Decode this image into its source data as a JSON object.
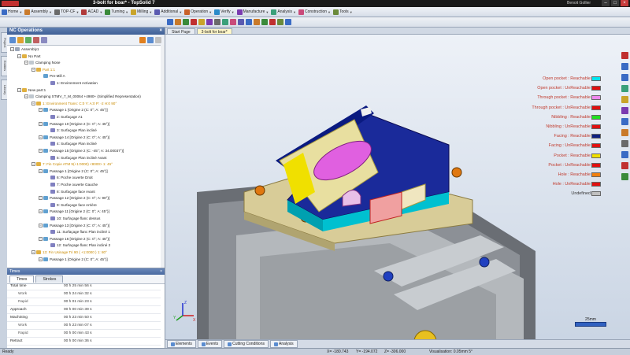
{
  "app": {
    "title": "3-bolt for boar* - TopSolid 7",
    "user": "Benoit Gollier"
  },
  "window_controls": {
    "minimize": "–",
    "maximize": "□",
    "close": "×"
  },
  "menus": [
    {
      "label": "Home",
      "color": "#3a6bc4"
    },
    {
      "label": "Assembly",
      "color": "#c97a2a"
    },
    {
      "label": "TOP-CF",
      "color": "#6a6a6a"
    },
    {
      "label": "ACAD",
      "color": "#b03a3a"
    },
    {
      "label": "Turning",
      "color": "#3a8a3a"
    },
    {
      "label": "Milling",
      "color": "#c9a42a"
    },
    {
      "label": "Additional",
      "color": "#5a5ab0"
    },
    {
      "label": "Operation",
      "color": "#c9622a"
    },
    {
      "label": "Verify",
      "color": "#2a8ac9"
    },
    {
      "label": "Manufacture",
      "color": "#7a3ab0"
    },
    {
      "label": "Analysis",
      "color": "#3aa07a"
    },
    {
      "label": "Construction",
      "color": "#c94a7a"
    },
    {
      "label": "Tools",
      "color": "#6a8a3a"
    }
  ],
  "nc_panel": {
    "title": "NC Operations",
    "close": "×",
    "tree": [
      {
        "indent": 0,
        "exp": "−",
        "label": "Assembly1",
        "icon": "#9aa6b8",
        "style": ""
      },
      {
        "indent": 1,
        "exp": "−",
        "label": "No Part",
        "icon": "#e0b040",
        "style": ""
      },
      {
        "indent": 2,
        "exp": "−",
        "label": "Clamping Nose",
        "icon": "#c0c8d0",
        "style": ""
      },
      {
        "indent": 3,
        "exp": "−",
        "label": "Part 1:1",
        "icon": "#e0b040",
        "style": "hi"
      },
      {
        "indent": 4,
        "exp": "",
        "label": "Pre-Mill A",
        "icon": "#60a0d0",
        "style": ""
      },
      {
        "indent": 5,
        "exp": "",
        "label": "1: Environment Activation",
        "icon": "#8080c0",
        "style": ""
      },
      {
        "indent": 1,
        "exp": "−",
        "label": "New part:1",
        "icon": "#e0b040",
        "style": ""
      },
      {
        "indent": 2,
        "exp": "−",
        "label": "Clamping STMV_7_M_00064 +4980+ (Simplified Representation)",
        "icon": "#c0c8d0",
        "style": ""
      },
      {
        "indent": 3,
        "exp": "−",
        "label": "1: Environment Trans: C:0 Y: A:0 P: -2 H:0 90°",
        "icon": "#e0b040",
        "style": "hi"
      },
      {
        "indent": 4,
        "exp": "−",
        "label": "Passage 1 [Origine 2 (C: 0°; A: 45°)]",
        "icon": "#60a0d0",
        "style": ""
      },
      {
        "indent": 5,
        "exp": "",
        "label": "2: Surfaçage A1",
        "icon": "#8080c0",
        "style": ""
      },
      {
        "indent": 4,
        "exp": "−",
        "label": "Passage 10 [Origine 2 (C: 0°; A: 45°)]",
        "icon": "#60a0d0",
        "style": ""
      },
      {
        "indent": 5,
        "exp": "",
        "label": "3: Surfaçage Plan incliné",
        "icon": "#8080c0",
        "style": ""
      },
      {
        "indent": 4,
        "exp": "−",
        "label": "Passage 14 [Origine 2 (C: 0°; A: 45°)]",
        "icon": "#60a0d0",
        "style": ""
      },
      {
        "indent": 5,
        "exp": "",
        "label": "4: Surfaçage Plan incliné",
        "icon": "#8080c0",
        "style": ""
      },
      {
        "indent": 4,
        "exp": "−",
        "label": "Passage 15 [Origine 2 (C: -45°; A: 34.00037°)]",
        "icon": "#60a0d0",
        "style": ""
      },
      {
        "indent": 5,
        "exp": "",
        "label": "5: Surfaçage Plan incliné Avant",
        "icon": "#8080c0",
        "style": ""
      },
      {
        "indent": 3,
        "exp": "−",
        "label": "7: Fin Copie ATM 9(+1:0000) <8000> 1: 45°",
        "icon": "#e0b040",
        "style": "hi"
      },
      {
        "indent": 4,
        "exp": "−",
        "label": "Passage 1 [Origine 2 (C: 0°; A: 45°)]",
        "icon": "#60a0d0",
        "style": ""
      },
      {
        "indent": 5,
        "exp": "",
        "label": "6: Poche ouverte Droit",
        "icon": "#8080c0",
        "style": ""
      },
      {
        "indent": 5,
        "exp": "",
        "label": "7: Poche ouverte Gauche",
        "icon": "#8080c0",
        "style": ""
      },
      {
        "indent": 5,
        "exp": "",
        "label": "8: Surfaçage face Avant",
        "icon": "#8080c0",
        "style": ""
      },
      {
        "indent": 4,
        "exp": "−",
        "label": "Passage 12 [Origine 2 (C: 0°; A: 90°)]",
        "icon": "#60a0d0",
        "style": ""
      },
      {
        "indent": 5,
        "exp": "",
        "label": "9: Surfaçage face Arrière",
        "icon": "#8080c0",
        "style": ""
      },
      {
        "indent": 4,
        "exp": "−",
        "label": "Passage 11 [Origine 2 (C: 0°; A: 45°)]",
        "icon": "#60a0d0",
        "style": ""
      },
      {
        "indent": 5,
        "exp": "",
        "label": "10: Surfaçage flanc dessus",
        "icon": "#8080c0",
        "style": ""
      },
      {
        "indent": 4,
        "exp": "−",
        "label": "Passage 13 [Origine 2 (C: 0°; A: 45°)]",
        "icon": "#60a0d0",
        "style": ""
      },
      {
        "indent": 5,
        "exp": "",
        "label": "11: Surfaçage flanc Plan incliné 1",
        "icon": "#8080c0",
        "style": ""
      },
      {
        "indent": 4,
        "exp": "−",
        "label": "Passage 16 [Origine 2 (C: 0°; A: 45°)]",
        "icon": "#60a0d0",
        "style": ""
      },
      {
        "indent": 5,
        "exp": "",
        "label": "12: Surfaçage flanc Plan incliné 2",
        "icon": "#8080c0",
        "style": ""
      },
      {
        "indent": 3,
        "exp": "−",
        "label": "13: Fin Usinage Tri 90 ( +1:0000 ) 1: 80°",
        "icon": "#e0b040",
        "style": "hi"
      },
      {
        "indent": 4,
        "exp": "−",
        "label": "Passage 1 [Origine 2 (C: 0°; A: 45°)]",
        "icon": "#60a0d0",
        "style": ""
      }
    ]
  },
  "times_panel": {
    "title": "Times",
    "close": "×",
    "tabs": [
      "Times",
      "Strokes"
    ],
    "rows": [
      {
        "k": "Total time",
        "v": "00 h 25 min 56 s",
        "sub": false
      },
      {
        "k": "Work",
        "v": "00 h 24 min 32 s",
        "sub": true
      },
      {
        "k": "Rapid",
        "v": "00 h 01 min 23 s",
        "sub": true
      },
      {
        "k": "Approach",
        "v": "00 h 00 min 39 s",
        "sub": false
      },
      {
        "k": "Machining",
        "v": "00 h 23 min 50 s",
        "sub": false
      },
      {
        "k": "Work",
        "v": "00 h 23 min 07 s",
        "sub": true
      },
      {
        "k": "Rapid",
        "v": "00 h 00 min 43 s",
        "sub": true
      },
      {
        "k": "Retract",
        "v": "00 h 00 min 36 s",
        "sub": false
      }
    ]
  },
  "viewport": {
    "tabs": [
      "Start Page",
      "3-bolt for boar*"
    ],
    "legend": [
      {
        "label": "Open pocket : Reachable",
        "color": "#00e6f0"
      },
      {
        "label": "Open pocket : UnReachable",
        "color": "#e01010"
      },
      {
        "label": "Through pocket : Reachable",
        "color": "#ee88ee"
      },
      {
        "label": "Through pocket : UnReachable",
        "color": "#e01010"
      },
      {
        "label": "Nibbling : Reachable",
        "color": "#20e020"
      },
      {
        "label": "Nibbling : UnReachable",
        "color": "#e01010"
      },
      {
        "label": "Facing : Reachable",
        "color": "#102080"
      },
      {
        "label": "Facing : UnReachable",
        "color": "#e01010"
      },
      {
        "label": "Pocket : Reachable",
        "color": "#f0e000"
      },
      {
        "label": "Pocket : UnReachable",
        "color": "#e01010"
      },
      {
        "label": "Hole : Reachable",
        "color": "#f08010"
      },
      {
        "label": "Hole : UnReachable",
        "color": "#e01010"
      },
      {
        "label": "Undefined",
        "color": "#c0c0c0"
      }
    ],
    "scale_label": "25mm",
    "triad": {
      "x": "X",
      "y": "Y",
      "z": "Z"
    }
  },
  "bottom_tabs": [
    "Elements",
    "Events",
    "Cutting Conditions",
    "Analysis"
  ],
  "status": {
    "ready": "Ready",
    "x": "X= -180.743",
    "y": "Y= -194.072",
    "z": "Z= -306.000",
    "vis": "Visualisation: 0.05mm 5°"
  }
}
